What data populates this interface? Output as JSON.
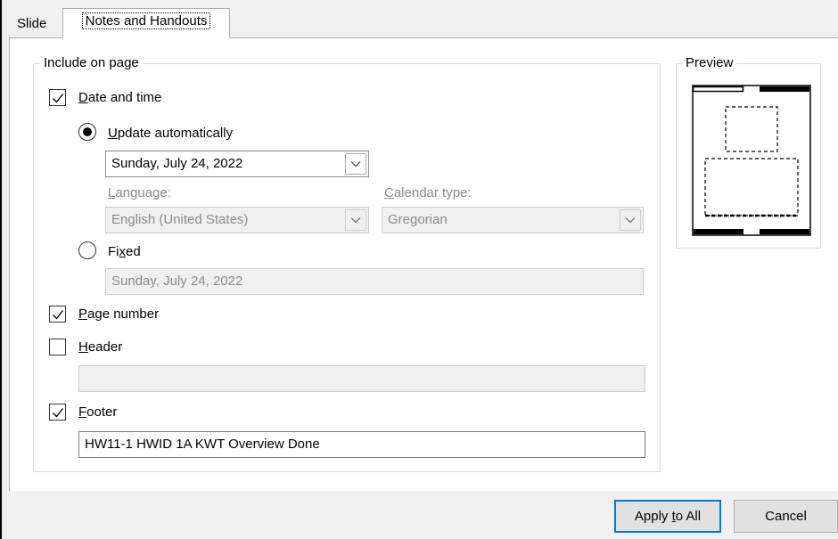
{
  "tabs": [
    {
      "label": "Slide",
      "active": false
    },
    {
      "label": "Notes and Handouts",
      "active": true
    }
  ],
  "include_group": {
    "legend": "Include on page",
    "date_time": {
      "checked": true,
      "label_underlined": "D",
      "label_rest": "ate and time",
      "update_automatically": {
        "selected": true,
        "label_underlined": "U",
        "label_rest": "pdate automatically",
        "date_value": "Sunday, July 24, 2022"
      },
      "language": {
        "label_underlined": "L",
        "label_rest": "anguage:",
        "value": "English (United States)"
      },
      "calendar_type": {
        "label_underlined": "C",
        "label_rest": "alendar type:",
        "value": "Gregorian"
      },
      "fixed": {
        "selected": false,
        "label_pre": "Fi",
        "label_underlined": "x",
        "label_rest": "ed",
        "value": "Sunday, July 24, 2022"
      }
    },
    "page_number": {
      "checked": true,
      "label_underlined": "P",
      "label_rest": "age number"
    },
    "header": {
      "checked": false,
      "label_underlined": "H",
      "label_rest": "eader",
      "value": ""
    },
    "footer": {
      "checked": true,
      "label_underlined": "F",
      "label_rest": "ooter",
      "value": "HW11-1 HWID 1A KWT Overview Done"
    }
  },
  "preview": {
    "legend": "Preview"
  },
  "buttons": {
    "apply_pre": "Apply ",
    "apply_underlined": "t",
    "apply_rest": "o All",
    "cancel": "Cancel"
  },
  "colors": {
    "accent": "#0078d7",
    "panel": "#ffffff",
    "background": "#f0f0f0"
  }
}
